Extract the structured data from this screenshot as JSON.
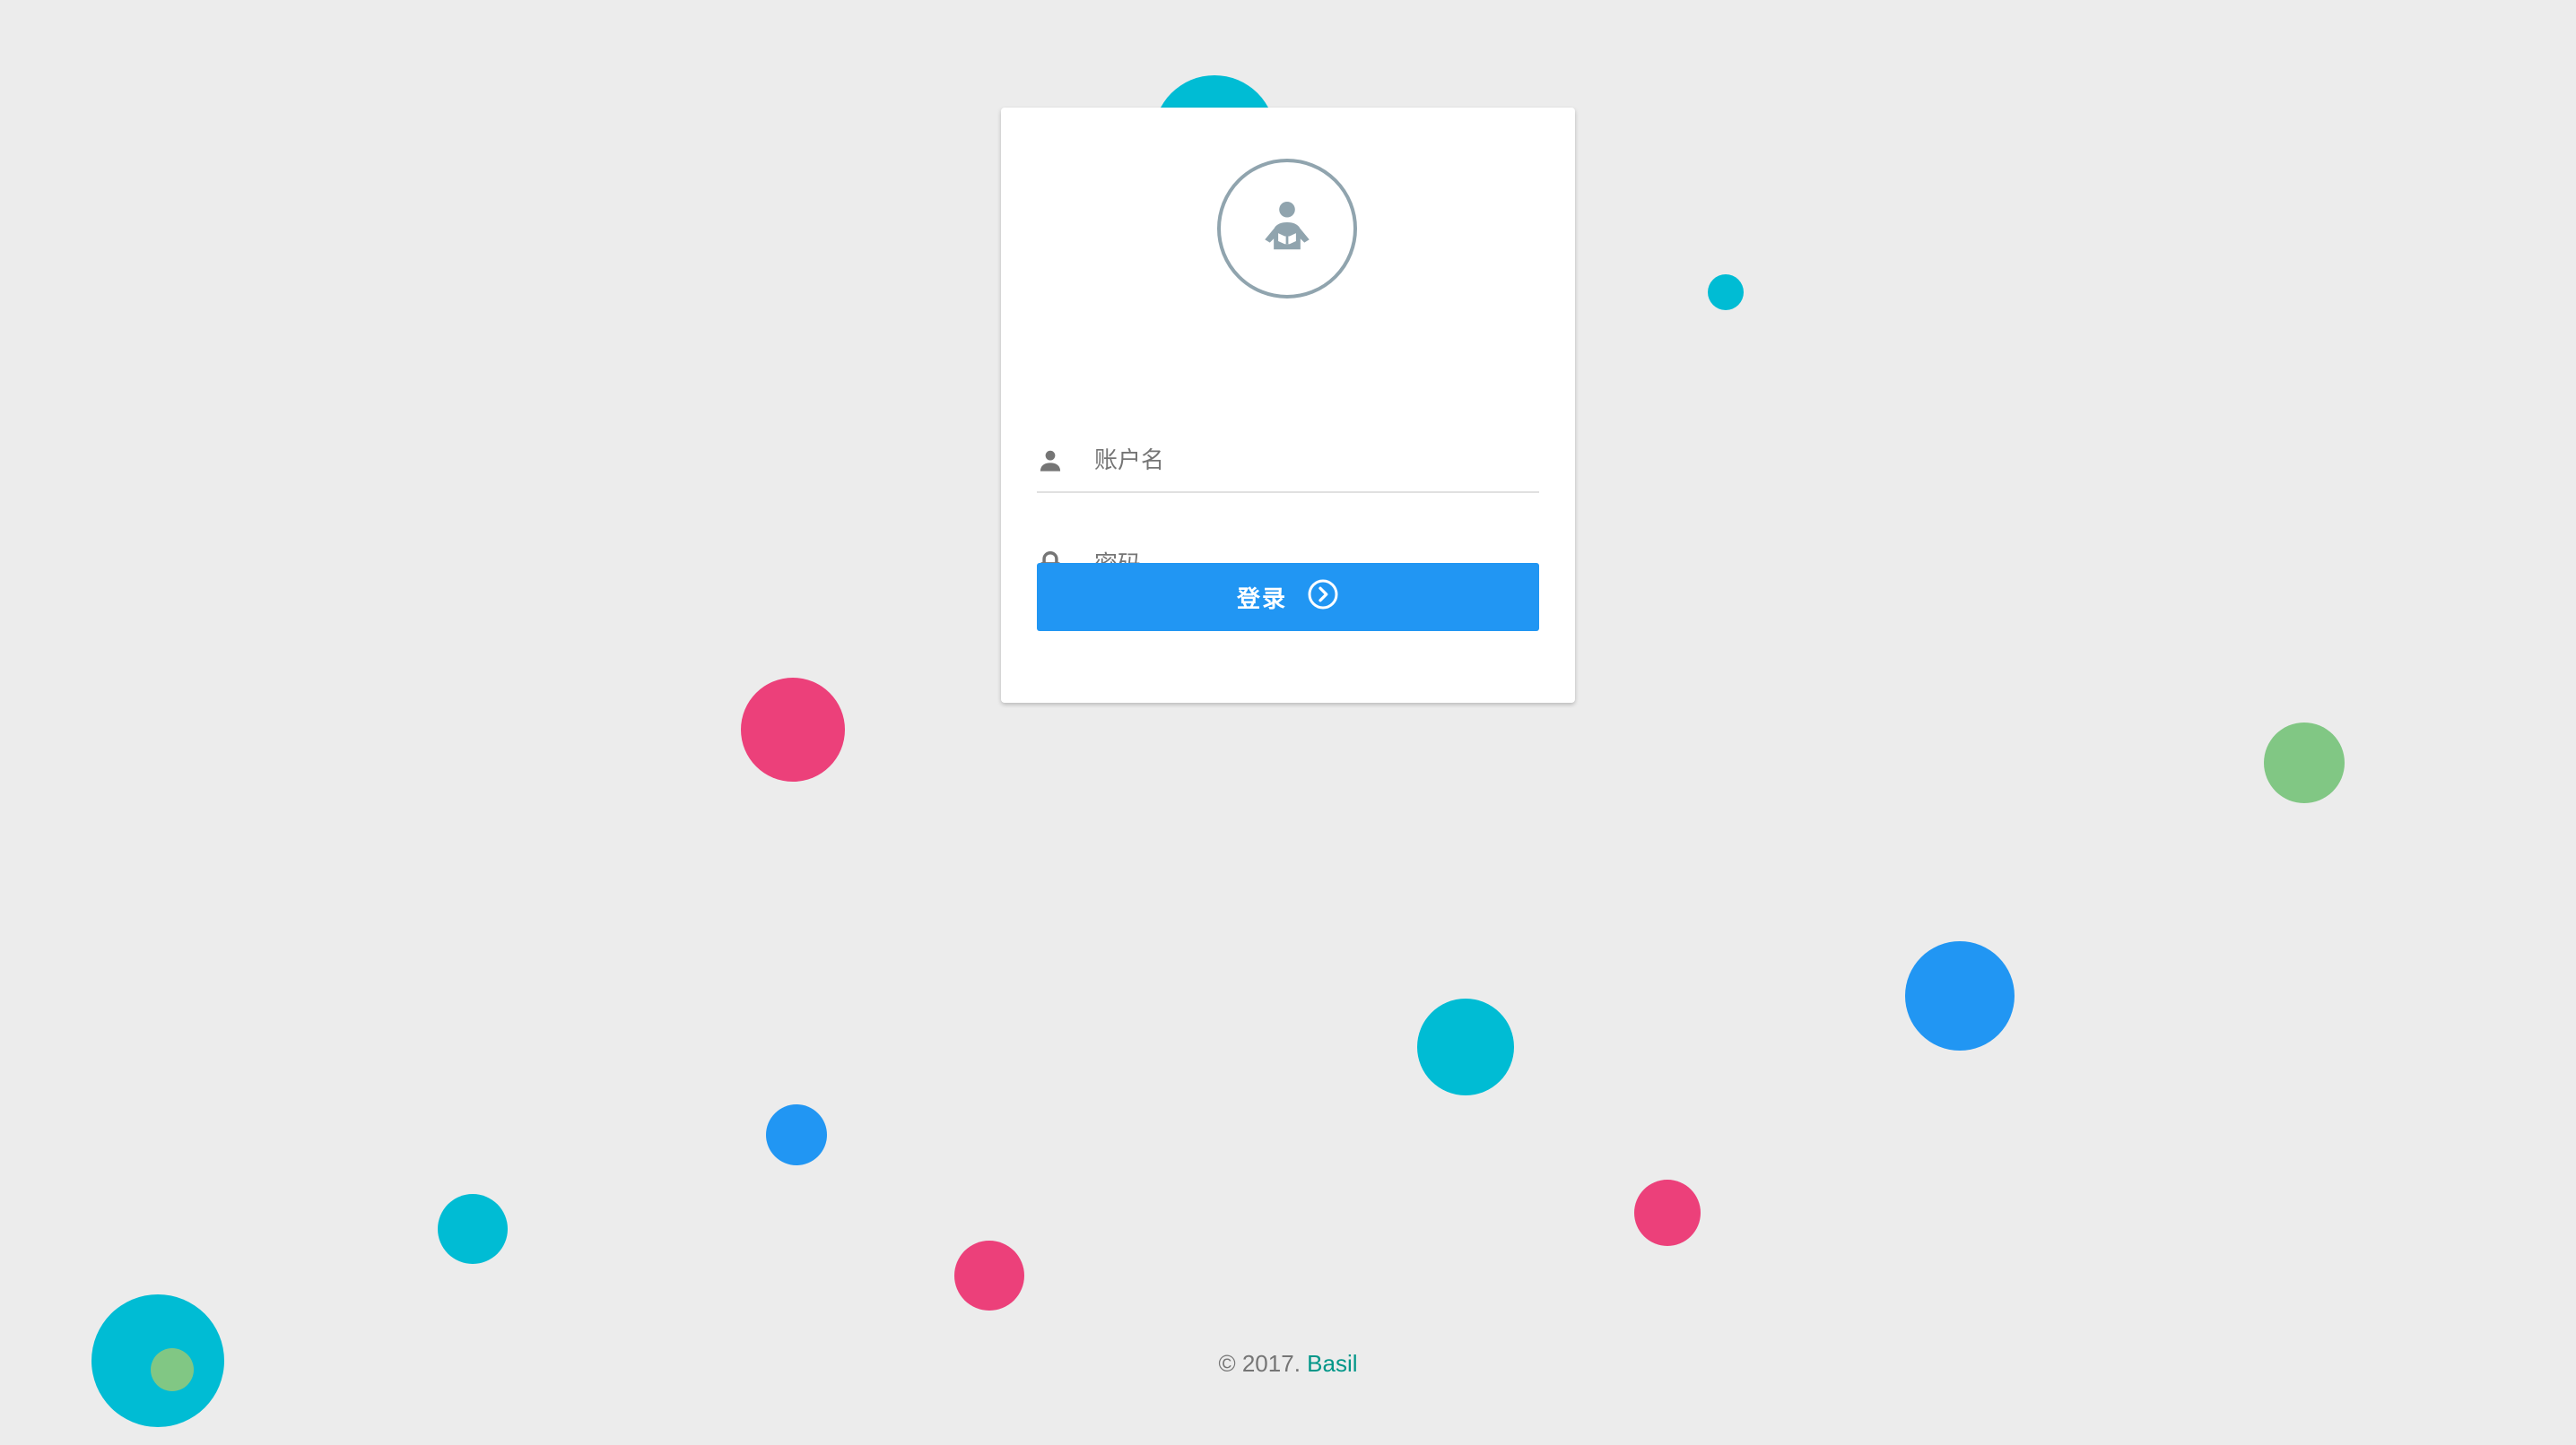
{
  "login_form": {
    "username_placeholder": "账户名",
    "password_placeholder": "密码",
    "submit_label": "登录"
  },
  "footer": {
    "copyright": "© 2017.",
    "brand": "Basil"
  },
  "colors": {
    "background": "#ececec",
    "primary": "#2196f3",
    "cyan": "#00bcd4",
    "pink": "#ec407a",
    "green": "#81c784",
    "icon_gray": "#90a4ae",
    "brand_link": "#009688"
  },
  "icons": {
    "avatar": "reader-icon",
    "username": "person-icon",
    "password": "lock-icon",
    "submit": "chevron-right-circle-icon"
  }
}
